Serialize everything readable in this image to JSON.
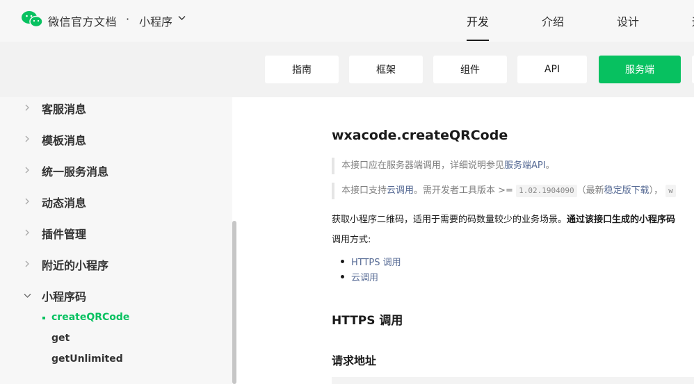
{
  "header": {
    "site_title": "微信官方文档",
    "separator": "·",
    "section": "小程序",
    "nav": [
      {
        "label": "开发",
        "active": true
      },
      {
        "label": "介绍",
        "active": false
      },
      {
        "label": "设计",
        "active": false
      },
      {
        "label": "运",
        "active": false
      }
    ]
  },
  "tabs": [
    {
      "label": "指南",
      "active": false
    },
    {
      "label": "框架",
      "active": false
    },
    {
      "label": "组件",
      "active": false
    },
    {
      "label": "API",
      "active": false
    },
    {
      "label": "服务端",
      "active": true
    }
  ],
  "sidebar": {
    "items": [
      {
        "label": "客服消息",
        "expanded": false
      },
      {
        "label": "模板消息",
        "expanded": false
      },
      {
        "label": "统一服务消息",
        "expanded": false
      },
      {
        "label": "动态消息",
        "expanded": false
      },
      {
        "label": "插件管理",
        "expanded": false
      },
      {
        "label": "附近的小程序",
        "expanded": false
      },
      {
        "label": "小程序码",
        "expanded": true
      }
    ],
    "subitems": [
      {
        "label": "createQRCode",
        "active": true
      },
      {
        "label": "get",
        "active": false
      },
      {
        "label": "getUnlimited",
        "active": false
      }
    ]
  },
  "content": {
    "title": "wxacode.createQRCode",
    "note1_prefix": "本接口应在服务器端调用，详细说明参见",
    "note1_link": "服务端API",
    "note1_suffix": "。",
    "note2_prefix": "本接口支持",
    "note2_link": "云调用",
    "note2_mid": "。需开发者工具版本 >= ",
    "note2_code": "1.02.1904090",
    "note2_paren_open": "（最新",
    "note2_link2": "稳定版下载",
    "note2_paren_close": "），",
    "note2_code2": "w",
    "desc_normal": "获取小程序二维码，适用于需要的码数量较少的业务场景。",
    "desc_bold": "通过该接口生成的小程序码",
    "call_label": "调用方式:",
    "call_methods": [
      "HTTPS 调用",
      "云调用"
    ],
    "h2_https": "HTTPS 调用",
    "h3_url": "请求地址"
  }
}
